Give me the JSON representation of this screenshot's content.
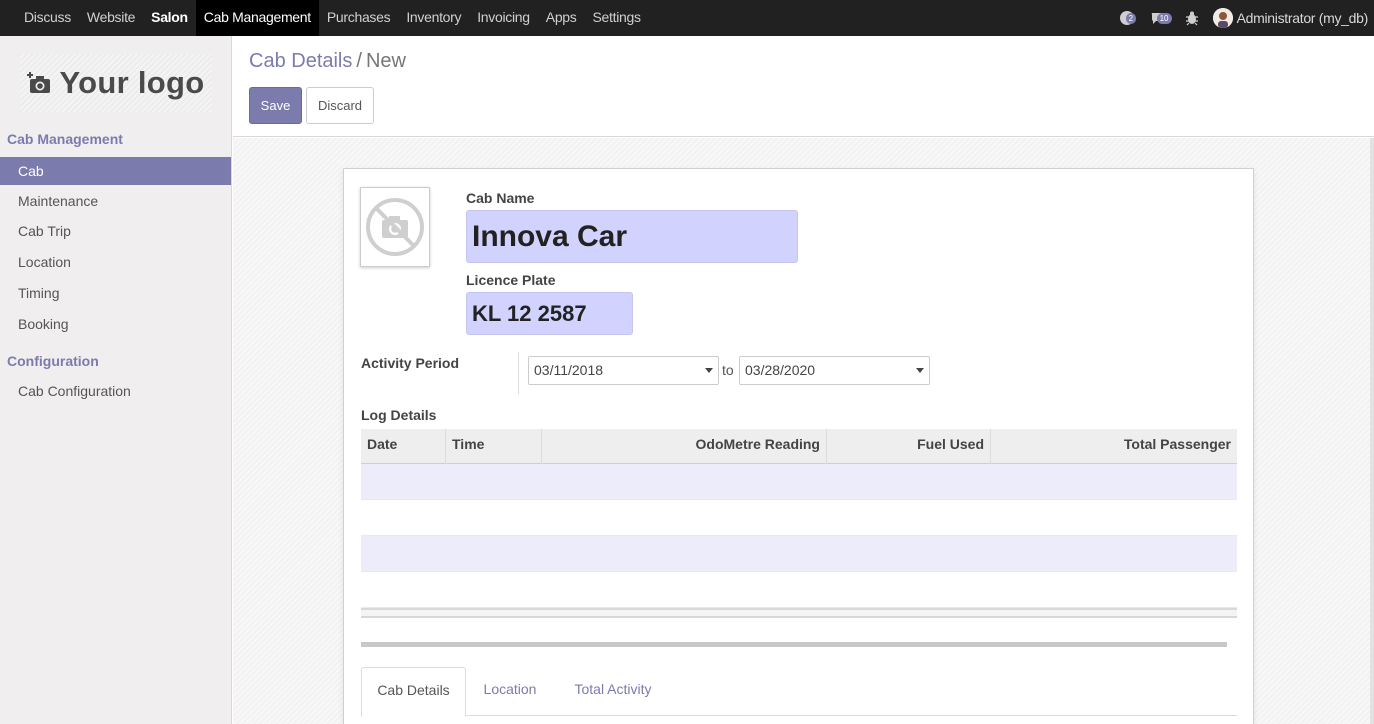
{
  "top_menu": [
    {
      "label": "Discuss"
    },
    {
      "label": "Website"
    },
    {
      "label": "Salon"
    },
    {
      "label": "Cab Management"
    },
    {
      "label": "Purchases"
    },
    {
      "label": "Inventory"
    },
    {
      "label": "Invoicing"
    },
    {
      "label": "Apps"
    },
    {
      "label": "Settings"
    }
  ],
  "systray": {
    "conversations_badge": "2",
    "messages_badge": "10",
    "user": "Administrator (my_db)"
  },
  "logo": {
    "text": "Your logo"
  },
  "sidebar": {
    "section1": "Cab Management",
    "section1_items": [
      {
        "label": "Cab"
      },
      {
        "label": "Maintenance"
      },
      {
        "label": "Cab Trip"
      },
      {
        "label": "Location"
      },
      {
        "label": "Timing"
      },
      {
        "label": "Booking"
      }
    ],
    "section2": "Configuration",
    "section2_items": [
      {
        "label": "Cab Configuration"
      }
    ]
  },
  "breadcrumb": {
    "parent": "Cab Details",
    "separator": "/",
    "current": "New"
  },
  "buttons": {
    "save": "Save",
    "discard": "Discard"
  },
  "form": {
    "cab_name_label": "Cab Name",
    "cab_name_value": "Innova Car",
    "licence_plate_label": "Licence Plate",
    "licence_plate_value": "KL 12 2587",
    "activity_period_label": "Activity Period",
    "date_from": "03/11/2018",
    "date_to_word": "to",
    "date_to": "03/28/2020",
    "log_details_label": "Log Details"
  },
  "log_table": {
    "columns": [
      "Date",
      "Time",
      "OdoMetre Reading",
      "Fuel Used",
      "Total Passenger"
    ]
  },
  "tabs": [
    {
      "label": "Cab Details"
    },
    {
      "label": "Location"
    },
    {
      "label": "Total Activity"
    }
  ]
}
